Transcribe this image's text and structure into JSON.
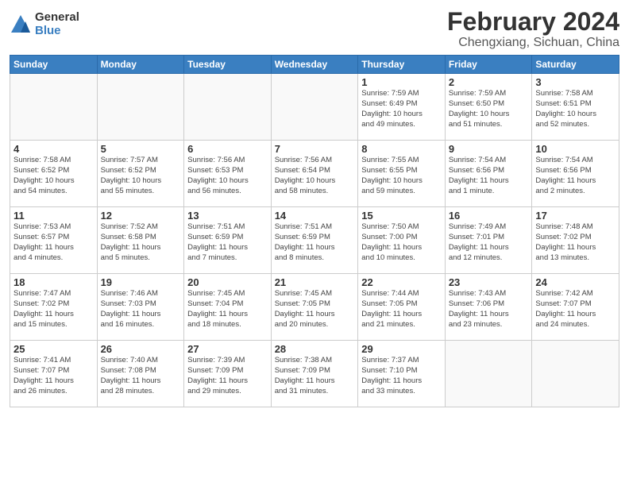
{
  "logo": {
    "general": "General",
    "blue": "Blue"
  },
  "title": "February 2024",
  "location": "Chengxiang, Sichuan, China",
  "weekdays": [
    "Sunday",
    "Monday",
    "Tuesday",
    "Wednesday",
    "Thursday",
    "Friday",
    "Saturday"
  ],
  "weeks": [
    [
      {
        "day": "",
        "info": ""
      },
      {
        "day": "",
        "info": ""
      },
      {
        "day": "",
        "info": ""
      },
      {
        "day": "",
        "info": ""
      },
      {
        "day": "1",
        "info": "Sunrise: 7:59 AM\nSunset: 6:49 PM\nDaylight: 10 hours\nand 49 minutes."
      },
      {
        "day": "2",
        "info": "Sunrise: 7:59 AM\nSunset: 6:50 PM\nDaylight: 10 hours\nand 51 minutes."
      },
      {
        "day": "3",
        "info": "Sunrise: 7:58 AM\nSunset: 6:51 PM\nDaylight: 10 hours\nand 52 minutes."
      }
    ],
    [
      {
        "day": "4",
        "info": "Sunrise: 7:58 AM\nSunset: 6:52 PM\nDaylight: 10 hours\nand 54 minutes."
      },
      {
        "day": "5",
        "info": "Sunrise: 7:57 AM\nSunset: 6:52 PM\nDaylight: 10 hours\nand 55 minutes."
      },
      {
        "day": "6",
        "info": "Sunrise: 7:56 AM\nSunset: 6:53 PM\nDaylight: 10 hours\nand 56 minutes."
      },
      {
        "day": "7",
        "info": "Sunrise: 7:56 AM\nSunset: 6:54 PM\nDaylight: 10 hours\nand 58 minutes."
      },
      {
        "day": "8",
        "info": "Sunrise: 7:55 AM\nSunset: 6:55 PM\nDaylight: 10 hours\nand 59 minutes."
      },
      {
        "day": "9",
        "info": "Sunrise: 7:54 AM\nSunset: 6:56 PM\nDaylight: 11 hours\nand 1 minute."
      },
      {
        "day": "10",
        "info": "Sunrise: 7:54 AM\nSunset: 6:56 PM\nDaylight: 11 hours\nand 2 minutes."
      }
    ],
    [
      {
        "day": "11",
        "info": "Sunrise: 7:53 AM\nSunset: 6:57 PM\nDaylight: 11 hours\nand 4 minutes."
      },
      {
        "day": "12",
        "info": "Sunrise: 7:52 AM\nSunset: 6:58 PM\nDaylight: 11 hours\nand 5 minutes."
      },
      {
        "day": "13",
        "info": "Sunrise: 7:51 AM\nSunset: 6:59 PM\nDaylight: 11 hours\nand 7 minutes."
      },
      {
        "day": "14",
        "info": "Sunrise: 7:51 AM\nSunset: 6:59 PM\nDaylight: 11 hours\nand 8 minutes."
      },
      {
        "day": "15",
        "info": "Sunrise: 7:50 AM\nSunset: 7:00 PM\nDaylight: 11 hours\nand 10 minutes."
      },
      {
        "day": "16",
        "info": "Sunrise: 7:49 AM\nSunset: 7:01 PM\nDaylight: 11 hours\nand 12 minutes."
      },
      {
        "day": "17",
        "info": "Sunrise: 7:48 AM\nSunset: 7:02 PM\nDaylight: 11 hours\nand 13 minutes."
      }
    ],
    [
      {
        "day": "18",
        "info": "Sunrise: 7:47 AM\nSunset: 7:02 PM\nDaylight: 11 hours\nand 15 minutes."
      },
      {
        "day": "19",
        "info": "Sunrise: 7:46 AM\nSunset: 7:03 PM\nDaylight: 11 hours\nand 16 minutes."
      },
      {
        "day": "20",
        "info": "Sunrise: 7:45 AM\nSunset: 7:04 PM\nDaylight: 11 hours\nand 18 minutes."
      },
      {
        "day": "21",
        "info": "Sunrise: 7:45 AM\nSunset: 7:05 PM\nDaylight: 11 hours\nand 20 minutes."
      },
      {
        "day": "22",
        "info": "Sunrise: 7:44 AM\nSunset: 7:05 PM\nDaylight: 11 hours\nand 21 minutes."
      },
      {
        "day": "23",
        "info": "Sunrise: 7:43 AM\nSunset: 7:06 PM\nDaylight: 11 hours\nand 23 minutes."
      },
      {
        "day": "24",
        "info": "Sunrise: 7:42 AM\nSunset: 7:07 PM\nDaylight: 11 hours\nand 24 minutes."
      }
    ],
    [
      {
        "day": "25",
        "info": "Sunrise: 7:41 AM\nSunset: 7:07 PM\nDaylight: 11 hours\nand 26 minutes."
      },
      {
        "day": "26",
        "info": "Sunrise: 7:40 AM\nSunset: 7:08 PM\nDaylight: 11 hours\nand 28 minutes."
      },
      {
        "day": "27",
        "info": "Sunrise: 7:39 AM\nSunset: 7:09 PM\nDaylight: 11 hours\nand 29 minutes."
      },
      {
        "day": "28",
        "info": "Sunrise: 7:38 AM\nSunset: 7:09 PM\nDaylight: 11 hours\nand 31 minutes."
      },
      {
        "day": "29",
        "info": "Sunrise: 7:37 AM\nSunset: 7:10 PM\nDaylight: 11 hours\nand 33 minutes."
      },
      {
        "day": "",
        "info": ""
      },
      {
        "day": "",
        "info": ""
      }
    ]
  ]
}
